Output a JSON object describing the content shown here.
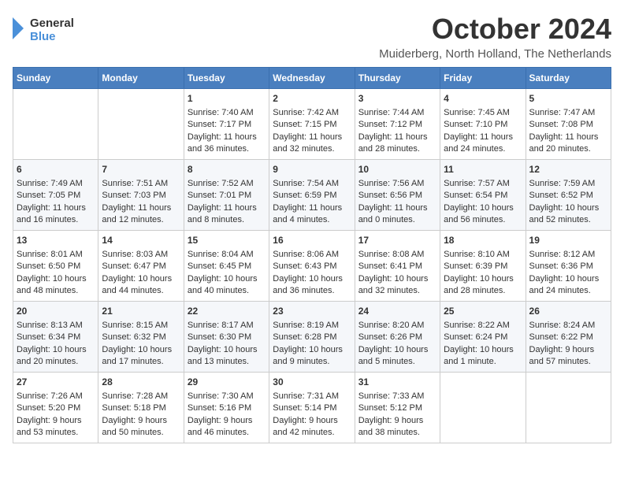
{
  "header": {
    "logo_line1": "General",
    "logo_line2": "Blue",
    "month": "October 2024",
    "location": "Muiderberg, North Holland, The Netherlands"
  },
  "days_of_week": [
    "Sunday",
    "Monday",
    "Tuesday",
    "Wednesday",
    "Thursday",
    "Friday",
    "Saturday"
  ],
  "weeks": [
    [
      {
        "day": "",
        "content": ""
      },
      {
        "day": "",
        "content": ""
      },
      {
        "day": "1",
        "content": "Sunrise: 7:40 AM\nSunset: 7:17 PM\nDaylight: 11 hours and 36 minutes."
      },
      {
        "day": "2",
        "content": "Sunrise: 7:42 AM\nSunset: 7:15 PM\nDaylight: 11 hours and 32 minutes."
      },
      {
        "day": "3",
        "content": "Sunrise: 7:44 AM\nSunset: 7:12 PM\nDaylight: 11 hours and 28 minutes."
      },
      {
        "day": "4",
        "content": "Sunrise: 7:45 AM\nSunset: 7:10 PM\nDaylight: 11 hours and 24 minutes."
      },
      {
        "day": "5",
        "content": "Sunrise: 7:47 AM\nSunset: 7:08 PM\nDaylight: 11 hours and 20 minutes."
      }
    ],
    [
      {
        "day": "6",
        "content": "Sunrise: 7:49 AM\nSunset: 7:05 PM\nDaylight: 11 hours and 16 minutes."
      },
      {
        "day": "7",
        "content": "Sunrise: 7:51 AM\nSunset: 7:03 PM\nDaylight: 11 hours and 12 minutes."
      },
      {
        "day": "8",
        "content": "Sunrise: 7:52 AM\nSunset: 7:01 PM\nDaylight: 11 hours and 8 minutes."
      },
      {
        "day": "9",
        "content": "Sunrise: 7:54 AM\nSunset: 6:59 PM\nDaylight: 11 hours and 4 minutes."
      },
      {
        "day": "10",
        "content": "Sunrise: 7:56 AM\nSunset: 6:56 PM\nDaylight: 11 hours and 0 minutes."
      },
      {
        "day": "11",
        "content": "Sunrise: 7:57 AM\nSunset: 6:54 PM\nDaylight: 10 hours and 56 minutes."
      },
      {
        "day": "12",
        "content": "Sunrise: 7:59 AM\nSunset: 6:52 PM\nDaylight: 10 hours and 52 minutes."
      }
    ],
    [
      {
        "day": "13",
        "content": "Sunrise: 8:01 AM\nSunset: 6:50 PM\nDaylight: 10 hours and 48 minutes."
      },
      {
        "day": "14",
        "content": "Sunrise: 8:03 AM\nSunset: 6:47 PM\nDaylight: 10 hours and 44 minutes."
      },
      {
        "day": "15",
        "content": "Sunrise: 8:04 AM\nSunset: 6:45 PM\nDaylight: 10 hours and 40 minutes."
      },
      {
        "day": "16",
        "content": "Sunrise: 8:06 AM\nSunset: 6:43 PM\nDaylight: 10 hours and 36 minutes."
      },
      {
        "day": "17",
        "content": "Sunrise: 8:08 AM\nSunset: 6:41 PM\nDaylight: 10 hours and 32 minutes."
      },
      {
        "day": "18",
        "content": "Sunrise: 8:10 AM\nSunset: 6:39 PM\nDaylight: 10 hours and 28 minutes."
      },
      {
        "day": "19",
        "content": "Sunrise: 8:12 AM\nSunset: 6:36 PM\nDaylight: 10 hours and 24 minutes."
      }
    ],
    [
      {
        "day": "20",
        "content": "Sunrise: 8:13 AM\nSunset: 6:34 PM\nDaylight: 10 hours and 20 minutes."
      },
      {
        "day": "21",
        "content": "Sunrise: 8:15 AM\nSunset: 6:32 PM\nDaylight: 10 hours and 17 minutes."
      },
      {
        "day": "22",
        "content": "Sunrise: 8:17 AM\nSunset: 6:30 PM\nDaylight: 10 hours and 13 minutes."
      },
      {
        "day": "23",
        "content": "Sunrise: 8:19 AM\nSunset: 6:28 PM\nDaylight: 10 hours and 9 minutes."
      },
      {
        "day": "24",
        "content": "Sunrise: 8:20 AM\nSunset: 6:26 PM\nDaylight: 10 hours and 5 minutes."
      },
      {
        "day": "25",
        "content": "Sunrise: 8:22 AM\nSunset: 6:24 PM\nDaylight: 10 hours and 1 minute."
      },
      {
        "day": "26",
        "content": "Sunrise: 8:24 AM\nSunset: 6:22 PM\nDaylight: 9 hours and 57 minutes."
      }
    ],
    [
      {
        "day": "27",
        "content": "Sunrise: 7:26 AM\nSunset: 5:20 PM\nDaylight: 9 hours and 53 minutes."
      },
      {
        "day": "28",
        "content": "Sunrise: 7:28 AM\nSunset: 5:18 PM\nDaylight: 9 hours and 50 minutes."
      },
      {
        "day": "29",
        "content": "Sunrise: 7:30 AM\nSunset: 5:16 PM\nDaylight: 9 hours and 46 minutes."
      },
      {
        "day": "30",
        "content": "Sunrise: 7:31 AM\nSunset: 5:14 PM\nDaylight: 9 hours and 42 minutes."
      },
      {
        "day": "31",
        "content": "Sunrise: 7:33 AM\nSunset: 5:12 PM\nDaylight: 9 hours and 38 minutes."
      },
      {
        "day": "",
        "content": ""
      },
      {
        "day": "",
        "content": ""
      }
    ]
  ]
}
